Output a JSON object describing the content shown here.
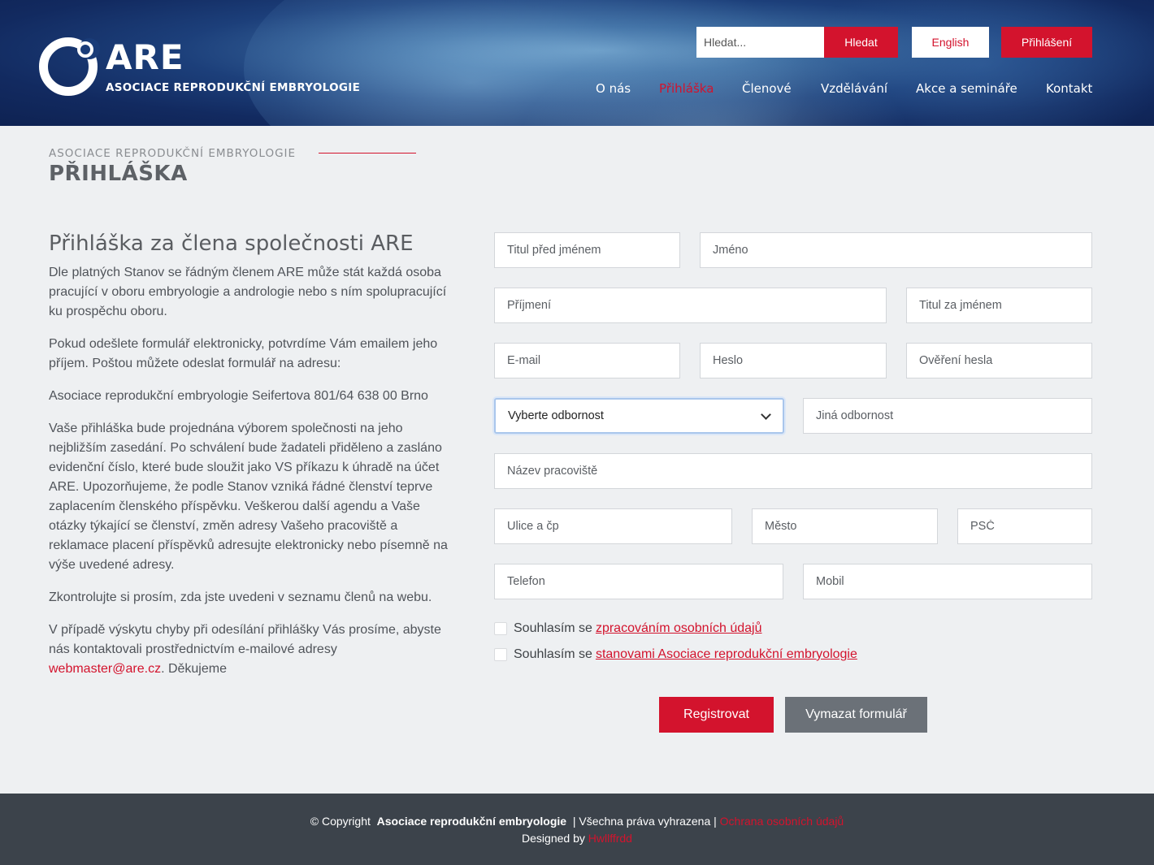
{
  "header": {
    "logo": {
      "short": "ARE",
      "name": "ASOCIACE REPRODUKČNÍ EMBRYOLOGIE"
    },
    "search": {
      "placeholder": "Hledat...",
      "button": "Hledat"
    },
    "language_button": "English",
    "login_button": "Přihlášení",
    "nav": [
      {
        "label": "O nás",
        "active": false
      },
      {
        "label": "Přihláška",
        "active": true
      },
      {
        "label": "Členové",
        "active": false
      },
      {
        "label": "Vzdělávání",
        "active": false
      },
      {
        "label": "Akce a semináře",
        "active": false
      },
      {
        "label": "Kontakt",
        "active": false
      }
    ]
  },
  "page": {
    "eyebrow": "ASOCIACE REPRODUKČNÍ EMBRYOLOGIE",
    "title": "PŘIHLÁŠKA"
  },
  "intro": {
    "heading": "Přihláška za člena společnosti ARE",
    "p1": "Dle platných Stanov se řádným členem ARE může stát každá osoba pracující v oboru embryologie a andrologie nebo s ním spolupracující ku prospěchu oboru.",
    "p2": "Pokud odešlete formulář elektronicky, potvrdíme Vám emailem jeho příjem. Poštou můžete odeslat formulář na adresu:",
    "p3": "Asociace reprodukční embryologie Seifertova 801/64 638 00 Brno",
    "p4": "Vaše přihláška bude projednána výborem společnosti na jeho nejbližším zasedání. Po schválení bude žadateli přiděleno a zasláno evidenční číslo, které bude sloužit jako VS příkazu k úhradě na účet ARE. Upozorňujeme, že podle Stanov vzniká řádné členství teprve zaplacením členského příspěvku. Veškerou další agendu a Vaše otázky týkající se členství, změn adresy Vašeho pracoviště a reklamace placení příspěvků adresujte elektronicky nebo písemně na výše uvedené adresy.",
    "p5": "Zkontrolujte si prosím, zda jste uvedeni v seznamu členů na webu.",
    "p6_before": "V případě výskytu chyby při odesílání přihlášky Vás prosíme, abyste nás kontaktovali prostřednictvím e-mailové adresy",
    "p6_email": "webmaster@are.cz",
    "p6_after": ". Děkujeme"
  },
  "form": {
    "title_before": "Titul před jménem",
    "first_name": "Jméno",
    "last_name": "Příjmení",
    "title_after": "Titul za jménem",
    "email": "E-mail",
    "password": "Heslo",
    "password_confirm": "Ověření hesla",
    "specialty_select": "Vyberte odbornost",
    "other_specialty": "Jiná odbornost",
    "workplace": "Název pracoviště",
    "street": "Ulice a čp",
    "city": "Město",
    "zip": "PSČ",
    "phone": "Telefon",
    "mobile": "Mobil",
    "consent1_text": "Souhlasím se",
    "consent1_link": "zpracováním osobních údajů",
    "consent2_text": "Souhlasím se",
    "consent2_link": "stanovami Asociace reprodukční embryologie",
    "submit": "Registrovat",
    "reset": "Vymazat formulář"
  },
  "footer": {
    "copyright": "© Copyright",
    "org": "Asociace reprodukční embryologie",
    "rights": "| Všechna práva vyhrazena |",
    "privacy": "Ochrana osobních údajů",
    "designed_by": "Designed by",
    "designer": "Hwllffrdd"
  },
  "colors": {
    "accent": "#d3132d",
    "header_blue": "#1c3f7a",
    "footer_bg": "#3c434b",
    "page_bg": "#eef0f2",
    "reset_button": "#6b7178"
  }
}
